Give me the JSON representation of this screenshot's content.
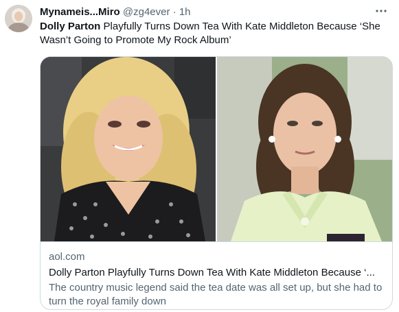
{
  "author": {
    "display_name": "Mynameis...Miro",
    "handle": "@zg4ever",
    "separator": "·",
    "time": "1h"
  },
  "icons": {
    "more": "more-horizontal-icon",
    "avatar": "avatar-image"
  },
  "tweet": {
    "highlight": "Dolly Parton",
    "rest": " Playfully Turns Down Tea With Kate Middleton Because ‘She Wasn’t Going to Promote My Rock Album’"
  },
  "card": {
    "domain": "aol.com",
    "title": "Dolly Parton Playfully Turns Down Tea With Kate Middleton Because ‘...",
    "description": "The country music legend said the tea date was all set up, but she had to turn the royal family down"
  },
  "colors": {
    "text_primary": "#0f1419",
    "text_secondary": "#536471",
    "border": "#cfd9de"
  }
}
